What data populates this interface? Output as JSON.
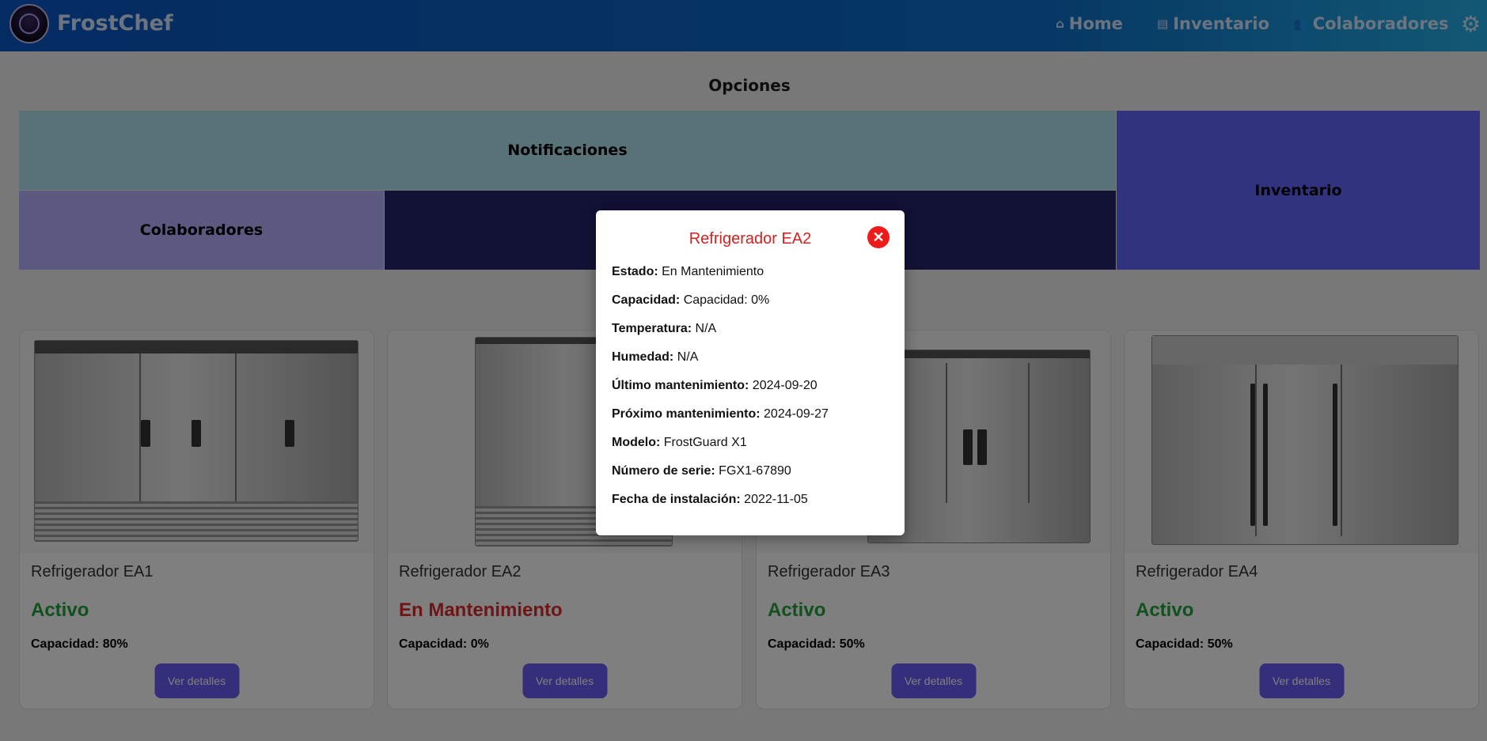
{
  "navbar": {
    "brand": "FrostChef",
    "items": [
      {
        "label": "Home",
        "icon": "home-icon"
      },
      {
        "label": "Inventario",
        "icon": "archive-icon"
      },
      {
        "label": "Colaboradores",
        "icon": "people-icon"
      }
    ],
    "settings_icon": "gear-icon"
  },
  "options": {
    "title": "Opciones",
    "tiles": {
      "notificaciones": "Notificaciones",
      "colaboradores": "Colaboradores",
      "inventario": "Inventario"
    }
  },
  "cards": [
    {
      "name": "Refrigerador EA1",
      "status": "Activo",
      "capacity": "Capacidad: 80%",
      "button": "Ver detalles"
    },
    {
      "name": "Refrigerador EA2",
      "status": "En Mantenimiento",
      "capacity": "Capacidad: 0%",
      "button": "Ver detalles"
    },
    {
      "name": "Refrigerador EA3",
      "status": "Activo",
      "capacity": "Capacidad: 50%",
      "button": "Ver detalles"
    },
    {
      "name": "Refrigerador EA4",
      "status": "Activo",
      "capacity": "Capacidad: 50%",
      "button": "Ver detalles"
    }
  ],
  "modal": {
    "title": "Refrigerador EA2",
    "close_icon": "close-icon",
    "fields": [
      {
        "label": "Estado:",
        "value": "En Mantenimiento"
      },
      {
        "label": "Capacidad:",
        "value": "Capacidad: 0%"
      },
      {
        "label": "Temperatura:",
        "value": "N/A"
      },
      {
        "label": "Humedad:",
        "value": "N/A"
      },
      {
        "label": "Último mantenimiento:",
        "value": "2024-09-20"
      },
      {
        "label": "Próximo mantenimiento:",
        "value": "2024-09-27"
      },
      {
        "label": "Modelo:",
        "value": "FrostGuard X1"
      },
      {
        "label": "Número de serie:",
        "value": "FGX1-67890"
      },
      {
        "label": "Fecha de instalación:",
        "value": "2022-11-05"
      }
    ]
  },
  "colors": {
    "status_active": "#21a33b",
    "status_maintenance": "#e02a2a",
    "button": "#6a5cf5",
    "modal_title": "#d32222"
  }
}
